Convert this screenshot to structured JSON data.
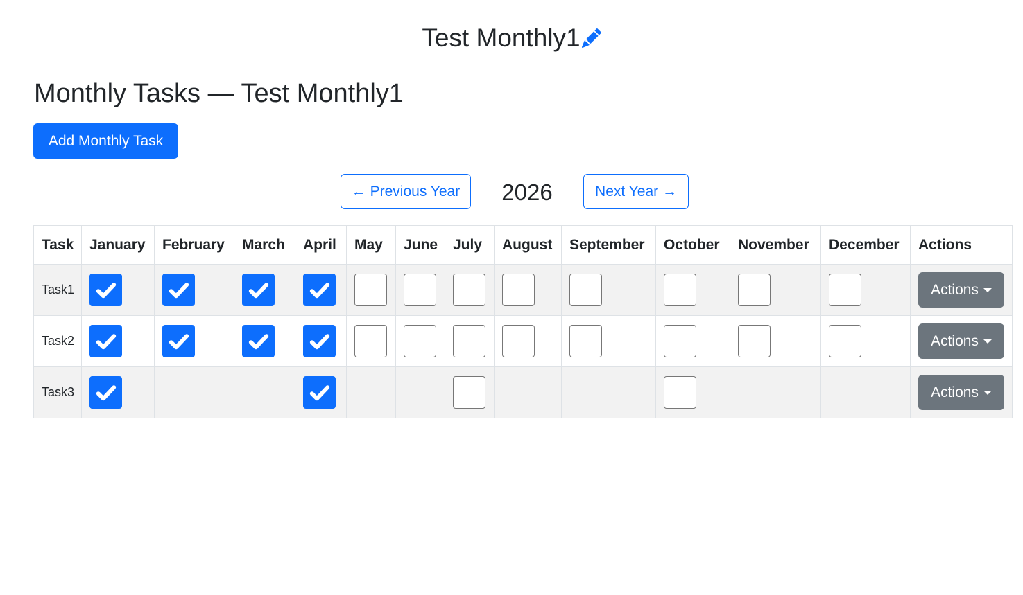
{
  "header": {
    "title": "Test Monthly1",
    "edit_icon": "pencil-icon"
  },
  "page": {
    "heading": "Monthly Tasks — Test Monthly1",
    "add_button": "Add Monthly Task"
  },
  "year_nav": {
    "prev_label": "← Previous Year",
    "year": "2026",
    "next_label": "Next Year →"
  },
  "colors": {
    "primary": "#0d6efd",
    "secondary": "#6c757d",
    "row_stripe": "#f2f2f2"
  },
  "table": {
    "columns": [
      "Task",
      "January",
      "February",
      "March",
      "April",
      "May",
      "June",
      "July",
      "August",
      "September",
      "October",
      "November",
      "December",
      "Actions"
    ],
    "rows": [
      {
        "name": "Task1",
        "actions_label": "Actions",
        "months": [
          "checked",
          "checked",
          "checked",
          "checked",
          "unchecked",
          "unchecked",
          "unchecked",
          "unchecked",
          "unchecked",
          "unchecked",
          "unchecked",
          "unchecked"
        ]
      },
      {
        "name": "Task2",
        "actions_label": "Actions",
        "months": [
          "checked",
          "checked",
          "checked",
          "checked",
          "unchecked",
          "unchecked",
          "unchecked",
          "unchecked",
          "unchecked",
          "unchecked",
          "unchecked",
          "unchecked"
        ]
      },
      {
        "name": "Task3",
        "actions_label": "Actions",
        "months": [
          "checked",
          "none",
          "none",
          "checked",
          "none",
          "none",
          "unchecked",
          "none",
          "none",
          "unchecked",
          "none",
          "none"
        ]
      }
    ]
  }
}
